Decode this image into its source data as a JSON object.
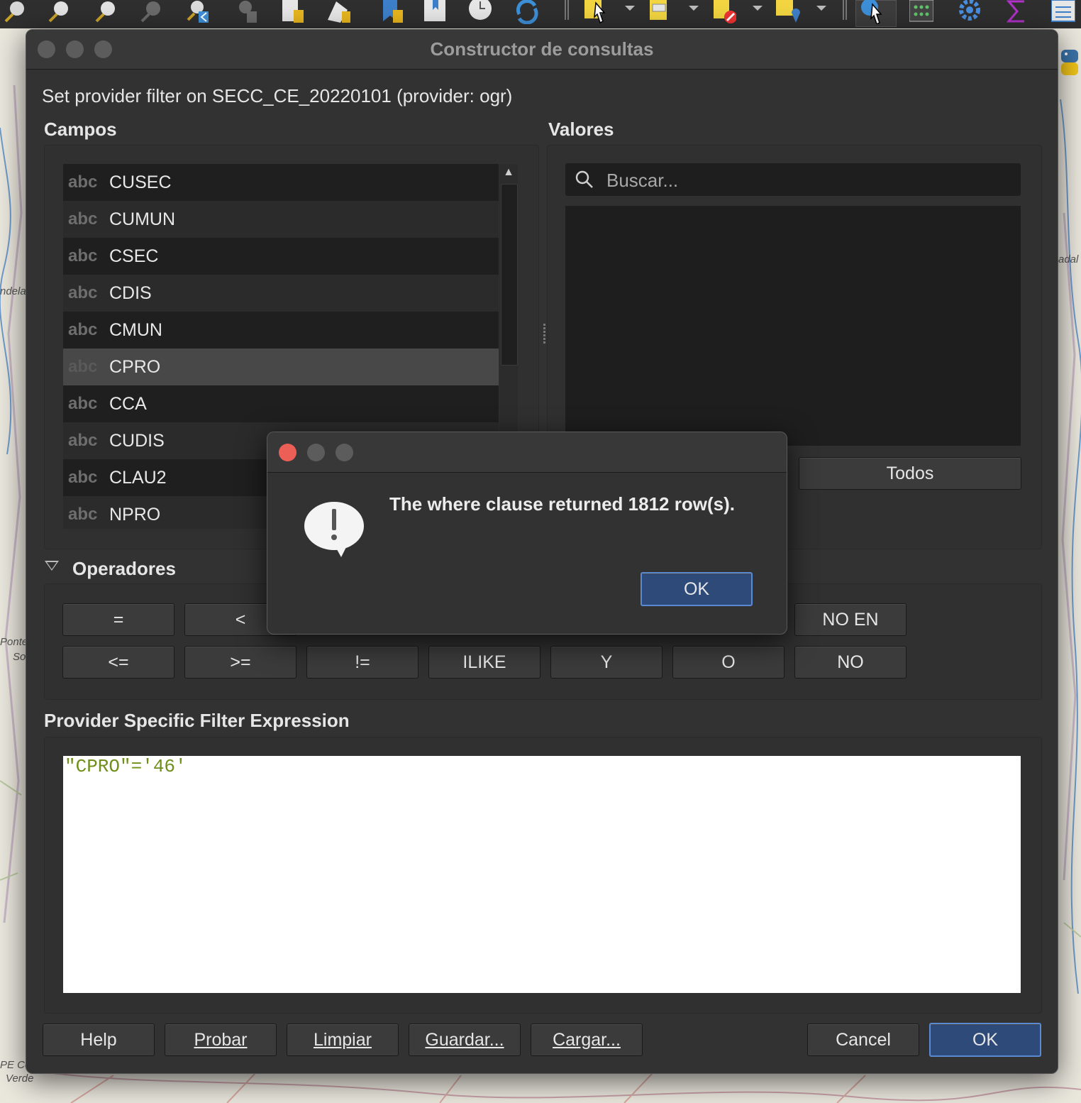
{
  "dialog": {
    "title": "Constructor de consultas",
    "subtitle": "Set provider filter on SECC_CE_20220101 (provider: ogr)"
  },
  "fields": {
    "label": "Campos",
    "type_label": "abc",
    "items": [
      "CUSEC",
      "CUMUN",
      "CSEC",
      "CDIS",
      "CMUN",
      "CPRO",
      "CCA",
      "CUDIS",
      "CLAU2",
      "NPRO"
    ],
    "selected": "CPRO"
  },
  "values": {
    "label": "Valores",
    "search_placeholder": "Buscar...",
    "all_button": "Todos"
  },
  "operators": {
    "label": "Operadores",
    "row1": [
      "=",
      "<",
      "NO EN"
    ],
    "row2": [
      "<=",
      ">=",
      "!=",
      "ILIKE",
      "Y",
      "O",
      "NO"
    ]
  },
  "expression": {
    "label": "Provider Specific Filter Expression",
    "text": "\"CPRO\"='46'"
  },
  "buttons": {
    "help": "Help",
    "test": "Probar",
    "clear": "Limpiar",
    "save": "Guardar...",
    "load": "Cargar...",
    "cancel": "Cancel",
    "ok": "OK"
  },
  "message": {
    "text": "The where clause returned 1812 row(s).",
    "ok": "OK"
  },
  "map_labels": [
    "ndela",
    "adal",
    "Ponte",
    "So",
    "PE Co",
    "Verde"
  ],
  "colors": {
    "accent": "#5b8ad4",
    "close_red": "#ec5f57",
    "expression_text": "#6f8f1a"
  }
}
